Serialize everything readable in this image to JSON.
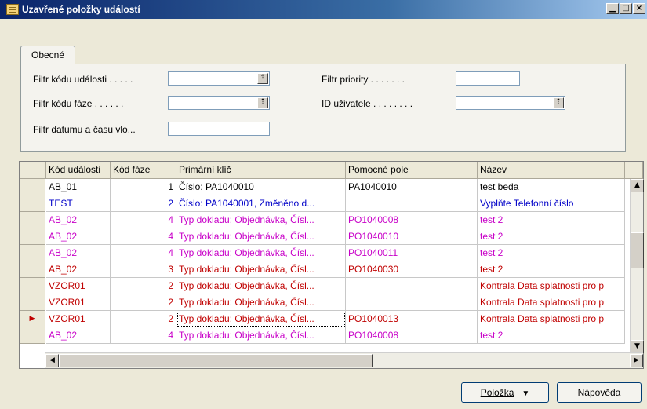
{
  "window": {
    "title": "Uzavřené položky událostí",
    "buttons": {
      "minimize": "▁",
      "maximize": "□",
      "close": "×"
    }
  },
  "tabs": [
    {
      "label": "Obecné"
    }
  ],
  "filters": {
    "event_code": {
      "label": "Filtr kódu události . . . . .",
      "value": ""
    },
    "phase_code": {
      "label": "Filtr kódu fáze . . . . . .",
      "value": ""
    },
    "datetime": {
      "label": "Filtr datumu a času vlo...",
      "value": ""
    },
    "priority": {
      "label": "Filtr priority . . . . . . .",
      "value": ""
    },
    "user_id": {
      "label": "ID uživatele . . . . . . . .",
      "value": ""
    },
    "dropdown_glyph": "⇡"
  },
  "grid": {
    "columns": [
      "Kód události",
      "Kód fáze",
      "Primární klíč",
      "Pomocné pole",
      "Název"
    ],
    "rows": [
      {
        "code": "AB_01",
        "phase": "1",
        "key": "Číslo: PA1040010",
        "aux": "PA1040010",
        "name": "test beda",
        "color": "black"
      },
      {
        "code": "TEST",
        "phase": "2",
        "key": "Číslo: PA1040001, Změněno d...",
        "aux": "",
        "name": "Vyplňte Telefonní číslo",
        "color": "blue"
      },
      {
        "code": "AB_02",
        "phase": "4",
        "key": "Typ dokladu: Objednávka, Čísl...",
        "aux": "PO1040008",
        "name": "test 2",
        "color": "magenta"
      },
      {
        "code": "AB_02",
        "phase": "4",
        "key": "Typ dokladu: Objednávka, Čísl...",
        "aux": "PO1040010",
        "name": "test 2",
        "color": "magenta"
      },
      {
        "code": "AB_02",
        "phase": "4",
        "key": "Typ dokladu: Objednávka, Čísl...",
        "aux": "PO1040011",
        "name": "test 2",
        "color": "magenta"
      },
      {
        "code": "AB_02",
        "phase": "3",
        "key": "Typ dokladu: Objednávka, Čísl...",
        "aux": "PO1040030",
        "name": "test 2",
        "color": "red"
      },
      {
        "code": "VZOR01",
        "phase": "2",
        "key": "Typ dokladu: Objednávka, Čísl...",
        "aux": "",
        "name": "Kontrala Data splatnosti pro p",
        "color": "red"
      },
      {
        "code": "VZOR01",
        "phase": "2",
        "key": "Typ dokladu: Objednávka, Čísl...",
        "aux": "",
        "name": "Kontrala Data splatnosti pro p",
        "color": "red"
      },
      {
        "code": "VZOR01",
        "phase": "2",
        "key": "Typ dokladu: Objednávka, Čísl...",
        "aux": "PO1040013",
        "name": "Kontrala Data splatnosti pro p",
        "color": "red",
        "current": true
      },
      {
        "code": "AB_02",
        "phase": "4",
        "key": "Typ dokladu: Objednávka, Čísl...",
        "aux": "PO1040008",
        "name": "test 2",
        "color": "magenta"
      }
    ],
    "current_row_marker": "▶",
    "scroll_up": "▲",
    "scroll_down": "▼",
    "scroll_left": "◀",
    "scroll_right": "▶"
  },
  "footer": {
    "item_button": {
      "label": "Položka",
      "arrow": "▼"
    },
    "help_button": {
      "label": "Nápověda"
    }
  },
  "colors": {
    "black": "#000000",
    "blue": "#0000c8",
    "magenta": "#c800c8",
    "red": "#c00000",
    "title_bar": "#0a246a"
  }
}
